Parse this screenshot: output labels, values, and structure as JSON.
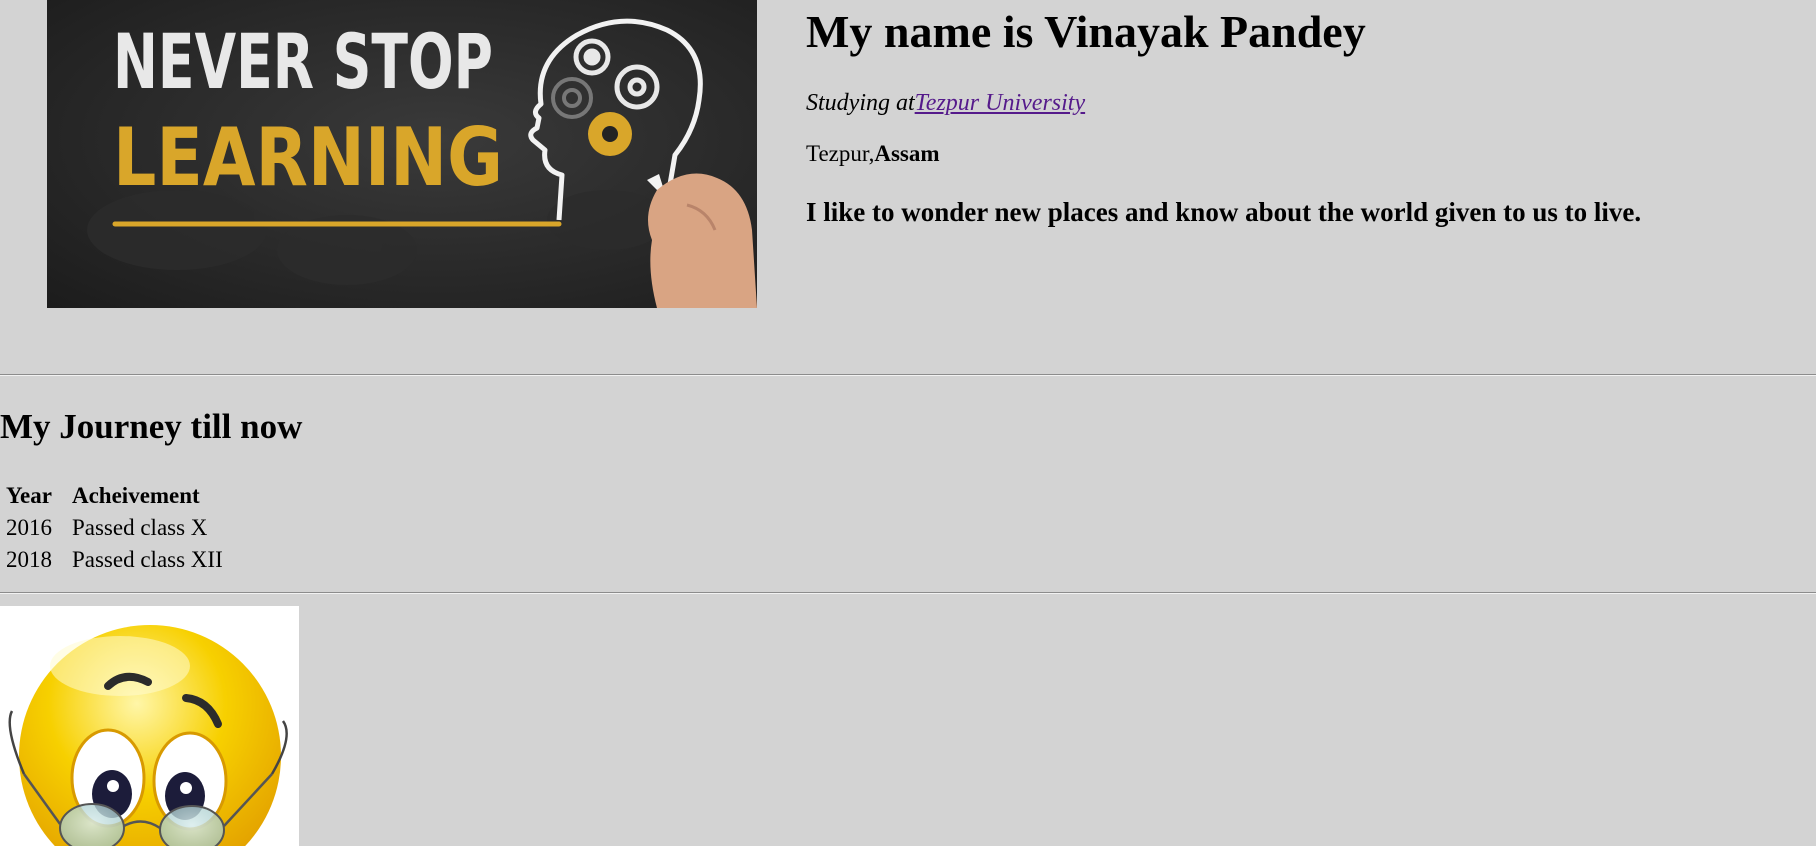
{
  "hero": {
    "image_text_line1": "NEVER STOP",
    "image_text_line2": "LEARNING"
  },
  "profile": {
    "name_heading": "My name is Vinayak Pandey",
    "study_prefix": "Studying at",
    "university_link": "Tezpur University",
    "city": "Tezpur,",
    "state": "Assam",
    "bio": "I like to wonder new places and know about the world given to us to live."
  },
  "journey": {
    "title": "My Journey till now",
    "columns": [
      "Year",
      "Acheivement"
    ],
    "rows": [
      {
        "year": "2016",
        "achievement": "Passed class X"
      },
      {
        "year": "2018",
        "achievement": "Passed class XII"
      }
    ]
  },
  "colors": {
    "background": "#d3d3d3",
    "link": "#551a8b",
    "chalkboard": "#232323",
    "chalk_yellow": "#d9a62a",
    "emoji_yellow": "#f7c600"
  },
  "icons": {
    "hero": "learning-head-gears-image",
    "emoji": "nerd-emoji-with-glasses"
  }
}
